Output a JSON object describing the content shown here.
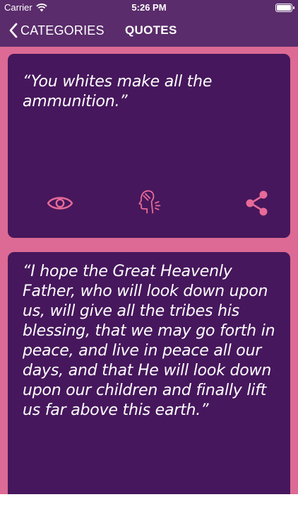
{
  "status_bar": {
    "carrier": "Carrier",
    "time": "5:26 PM"
  },
  "nav": {
    "back_label": "CATEGORIES",
    "title": "QUOTES"
  },
  "colors": {
    "header": "#5a2c6b",
    "background": "#dc6a94",
    "card": "#46175c",
    "icon": "#e76a98"
  },
  "quotes": [
    {
      "text": "“You whites make all the ammunition.”",
      "actions": [
        "eye-icon",
        "speaking-head-icon",
        "share-icon"
      ]
    },
    {
      "text": "“I hope the Great Heavenly Father, who will look down upon us, will give all the tribes his blessing, that we may go forth in peace, and live in peace all our days, and that He will look down upon our children and finally lift us far above this earth.”"
    }
  ]
}
